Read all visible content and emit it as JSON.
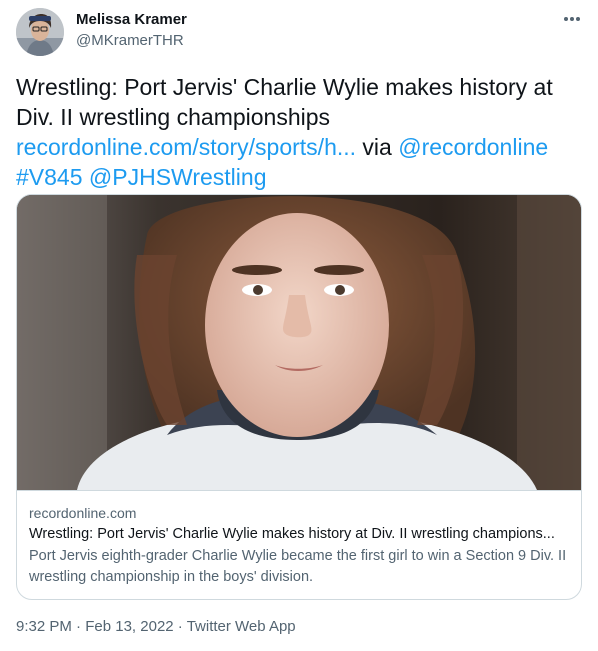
{
  "author": {
    "display_name": "Melissa Kramer",
    "handle": "@MKramerTHR"
  },
  "tweet": {
    "text_lines": [
      "Wrestling: Port Jervis' Charlie Wylie makes history at",
      "Div. II wrestling championships"
    ],
    "link_url": "recordonline.com/story/sports/h...",
    "via_word": "via",
    "mention_source": "@recordonline",
    "hashtag": "#V845",
    "mention_team": "@PJHSWrestling"
  },
  "card": {
    "domain": "recordonline.com",
    "title": "Wrestling: Port Jervis' Charlie Wylie makes history at Div. II wrestling champions...",
    "description": "Port Jervis eighth-grader Charlie Wylie became the first girl to win a Section 9 Div. II wrestling championship in the boys' division."
  },
  "meta": {
    "time": "9:32 PM",
    "separator": " · ",
    "date": "Feb 13, 2022",
    "source": "Twitter Web App"
  },
  "icons": {
    "more": "more-horizontal-icon"
  },
  "colors": {
    "link": "#1d9bf0",
    "text": "#0f1419",
    "muted": "#536471",
    "border": "#cfd9de"
  }
}
